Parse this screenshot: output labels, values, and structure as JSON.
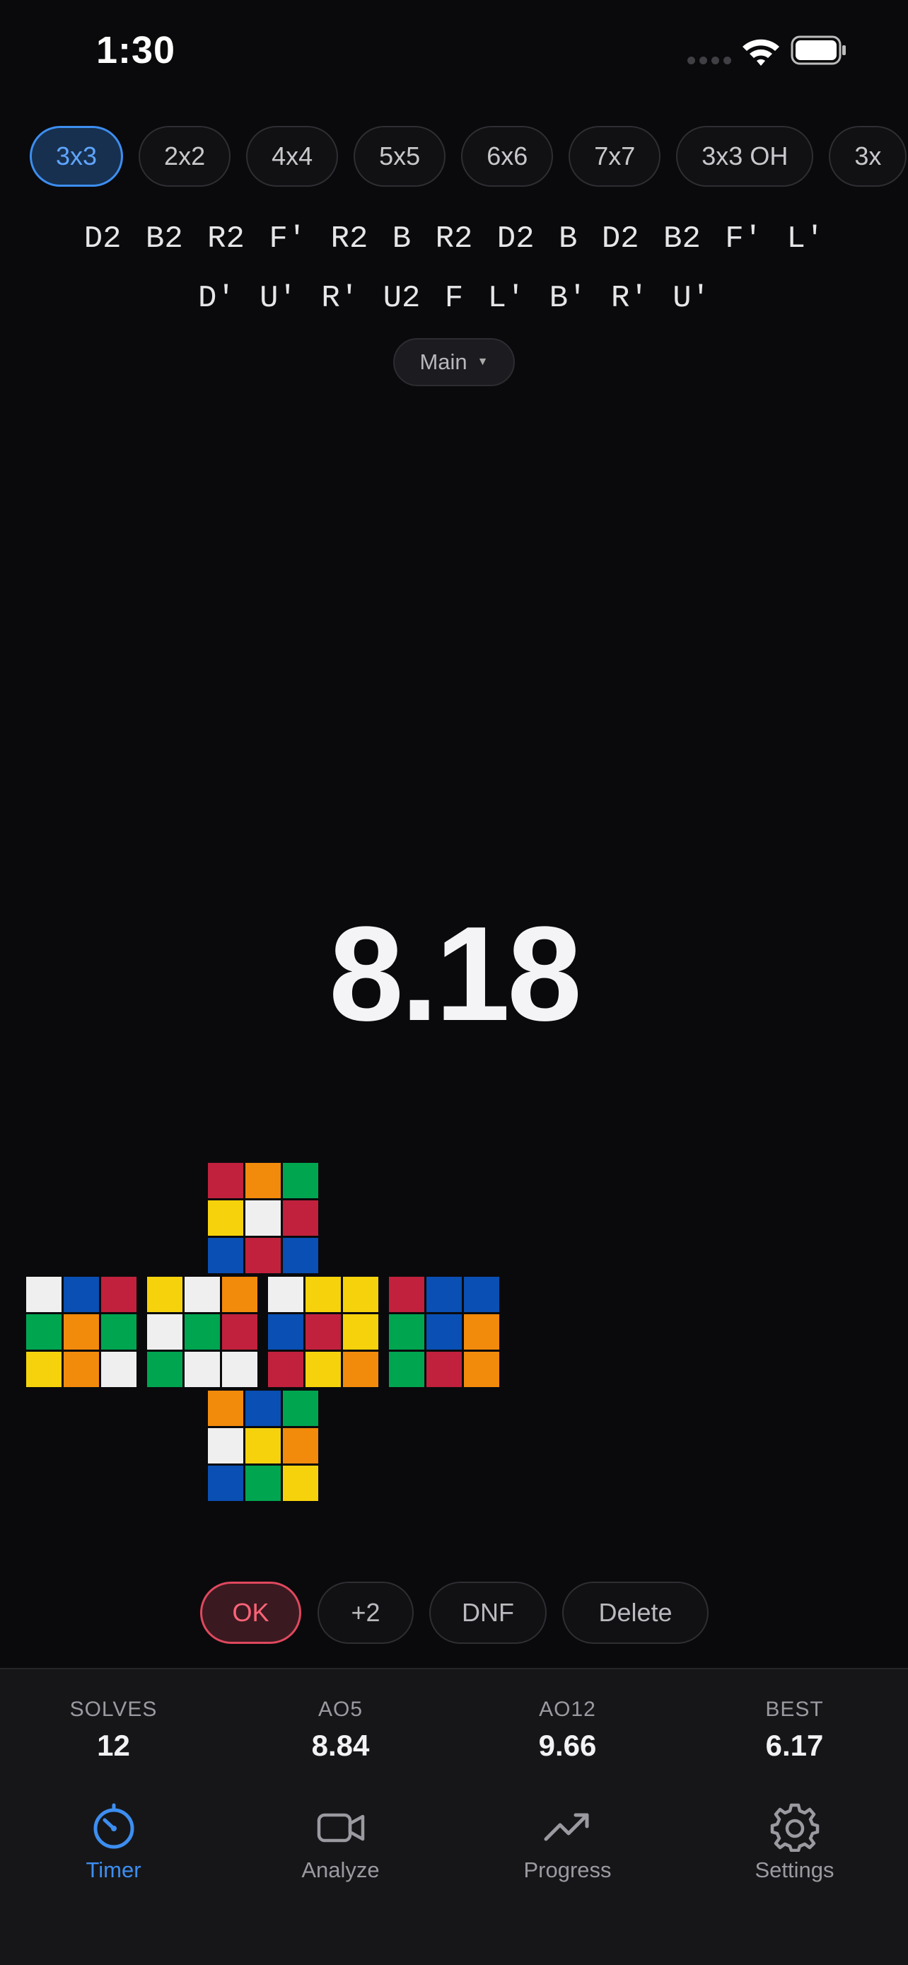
{
  "status_bar": {
    "time": "1:30"
  },
  "puzzles": [
    {
      "label": "3x3",
      "active": true
    },
    {
      "label": "2x2",
      "active": false
    },
    {
      "label": "4x4",
      "active": false
    },
    {
      "label": "5x5",
      "active": false
    },
    {
      "label": "6x6",
      "active": false
    },
    {
      "label": "7x7",
      "active": false
    },
    {
      "label": "3x3 OH",
      "active": false
    },
    {
      "label": "3x",
      "active": false
    }
  ],
  "scramble": {
    "line1": "D2 B2 R2 F' R2 B R2 D2 B D2 B2 F' L'",
    "line2": "D' U' R' U2 F L' B' R' U'"
  },
  "session": {
    "label": "Main"
  },
  "timer": {
    "value": "8.18"
  },
  "colors": {
    "R": "#c1213d",
    "O": "#f28a0c",
    "G": "#00a550",
    "Y": "#f6d20c",
    "W": "#efefef",
    "B": "#0a4fb3",
    "accent": "#3d8ef0",
    "ok": "#ff6478"
  },
  "cube_net": {
    "up": [
      "R",
      "O",
      "G",
      "Y",
      "W",
      "R",
      "B",
      "R",
      "B"
    ],
    "left": [
      "W",
      "B",
      "R",
      "G",
      "O",
      "G",
      "Y",
      "O",
      "W"
    ],
    "front": [
      "Y",
      "W",
      "O",
      "W",
      "G",
      "R",
      "G",
      "W",
      "W"
    ],
    "right": [
      "W",
      "Y",
      "Y",
      "B",
      "R",
      "Y",
      "R",
      "Y",
      "O"
    ],
    "back": [
      "R",
      "B",
      "B",
      "G",
      "B",
      "O",
      "G",
      "R",
      "O"
    ],
    "down": [
      "O",
      "B",
      "G",
      "W",
      "Y",
      "O",
      "B",
      "G",
      "Y"
    ]
  },
  "penalties": {
    "ok": "OK",
    "plus2": "+2",
    "dnf": "DNF",
    "delete": "Delete"
  },
  "stats": [
    {
      "label": "SOLVES",
      "value": "12"
    },
    {
      "label": "AO5",
      "value": "8.84"
    },
    {
      "label": "AO12",
      "value": "9.66"
    },
    {
      "label": "BEST",
      "value": "6.17"
    }
  ],
  "tabs": [
    {
      "label": "Timer",
      "icon": "timer-icon",
      "active": true
    },
    {
      "label": "Analyze",
      "icon": "video-icon",
      "active": false
    },
    {
      "label": "Progress",
      "icon": "trend-icon",
      "active": false
    },
    {
      "label": "Settings",
      "icon": "gear-icon",
      "active": false
    }
  ]
}
